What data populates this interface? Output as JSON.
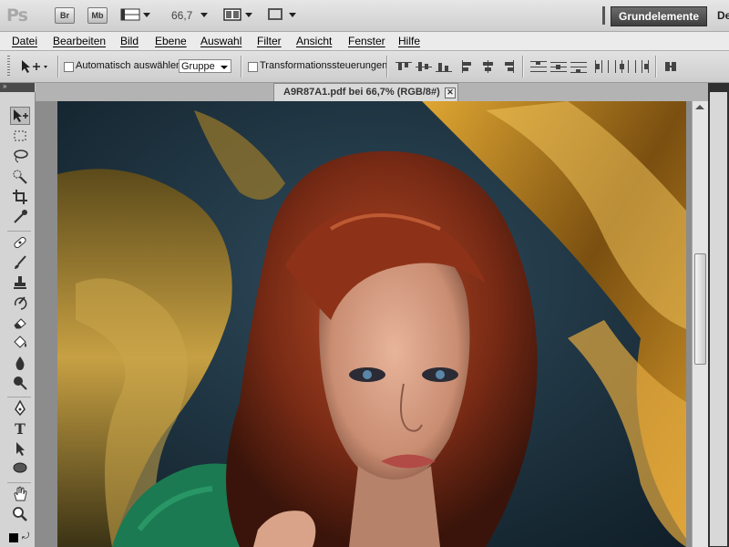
{
  "appbar": {
    "logo": "Ps",
    "bridge_label": "Br",
    "minibridge_label": "Mb",
    "zoom": "66,7",
    "workspace_button": "Grundelemente",
    "next_workspace_truncated": "De"
  },
  "menu": {
    "items": [
      "Datei",
      "Bearbeiten",
      "Bild",
      "Ebene",
      "Auswahl",
      "Filter",
      "Ansicht",
      "Fenster",
      "Hilfe"
    ]
  },
  "options": {
    "auto_select_label": "Automatisch auswählen:",
    "auto_select_value": "Gruppe",
    "transform_controls_label": "Transformationssteuerungen"
  },
  "tools_header": "»",
  "document": {
    "tab_title": "A9R87A1.pdf bei 66,7% (RGB/8#)",
    "close_glyph": "✕"
  },
  "scroll": {
    "vertical_position": 0.45
  },
  "colors": {
    "accent": "#4b4b4b",
    "gold": "#c58a1a",
    "hair": "#8a2e16",
    "backdrop": "#1e3442",
    "dress": "#1b7a52"
  }
}
